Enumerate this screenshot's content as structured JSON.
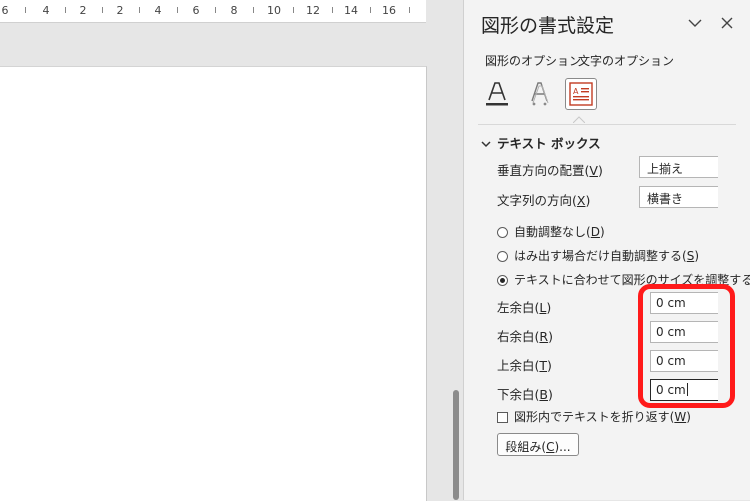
{
  "ruler": {
    "numbers": [
      "6",
      "4",
      "2",
      "2",
      "4",
      "6",
      "8",
      "10",
      "12",
      "14",
      "16"
    ]
  },
  "pane": {
    "title": "図形の書式設定",
    "collapse_icon": "chevron-down-icon",
    "close_icon": "close-icon",
    "tabs": {
      "shape_options": "図形のオプション",
      "text_options": "文字のオプション"
    },
    "icons": [
      "text-fill-outline-icon",
      "text-effects-icon",
      "textbox-icon"
    ],
    "section": {
      "title": "テキスト ボックス"
    },
    "vertical_align": {
      "label": "垂直方向の配置",
      "accel": "V",
      "value": "上揃え"
    },
    "text_direction": {
      "label": "文字列の方向",
      "accel": "X",
      "value": "横書き"
    },
    "autofit": [
      {
        "label": "自動調整なし",
        "accel": "D",
        "selected": false
      },
      {
        "label": "はみ出す場合だけ自動調整する",
        "accel": "S",
        "selected": false
      },
      {
        "label": "テキストに合わせて図形のサイズを調整する(",
        "accel": "",
        "selected": true
      }
    ],
    "margins": [
      {
        "label": "左余白",
        "accel": "L",
        "value": "0 cm"
      },
      {
        "label": "右余白",
        "accel": "R",
        "value": "0 cm"
      },
      {
        "label": "上余白",
        "accel": "T",
        "value": "0 cm"
      },
      {
        "label": "下余白",
        "accel": "B",
        "value": "0 cm"
      }
    ],
    "wrap": {
      "label": "図形内でテキストを折り返す",
      "accel": "W",
      "checked": false
    },
    "columns_button": {
      "label": "段組み",
      "accel": "C",
      "suffix": "..."
    }
  },
  "colors": {
    "highlight": "#ff1a1a",
    "pane_bg": "#f3f3f3",
    "doc_bg": "#e6e6e6"
  }
}
